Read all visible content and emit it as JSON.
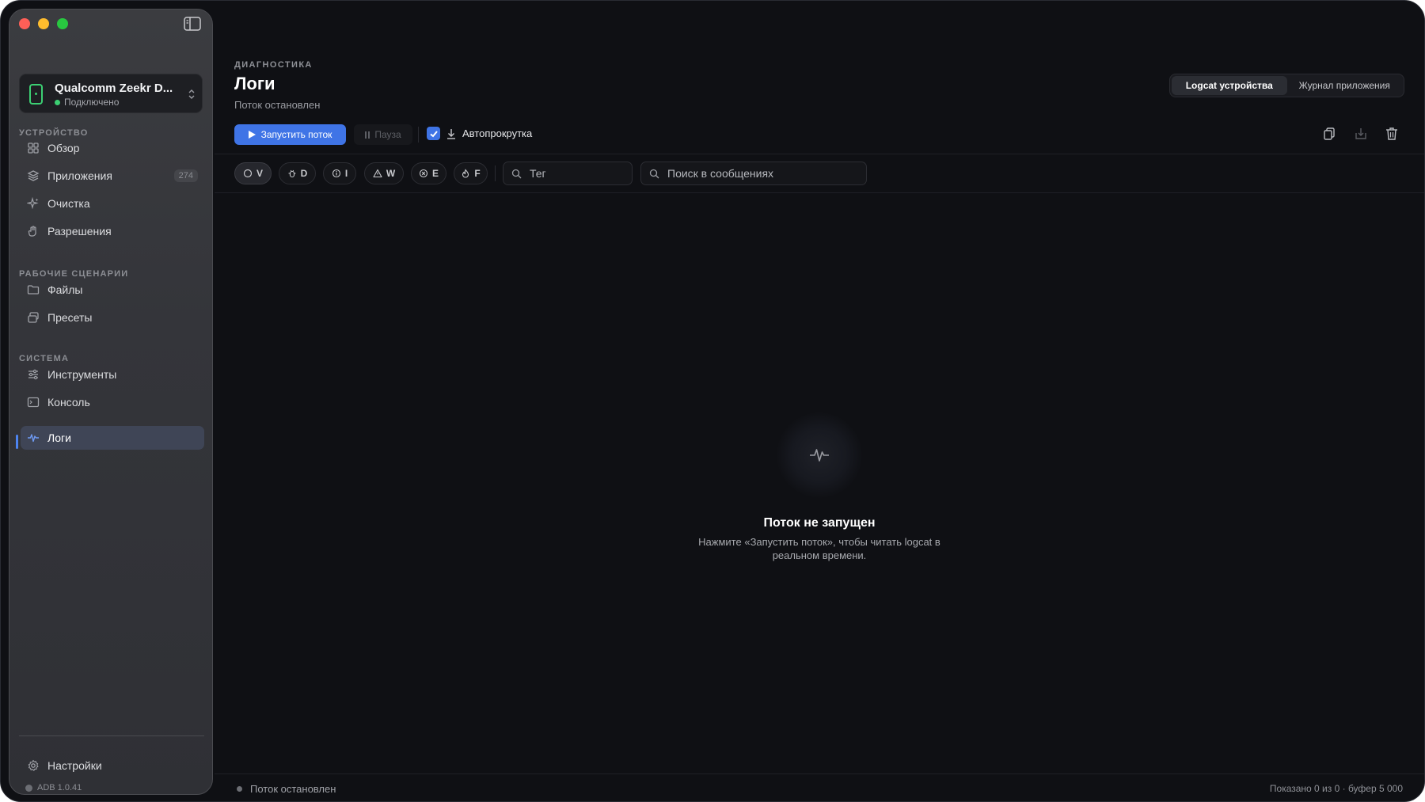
{
  "sidebar": {
    "device": {
      "name": "Qualcomm Zeekr D...",
      "status": "Подключено"
    },
    "sections": [
      {
        "title": "УСТРОЙСТВО"
      },
      {
        "title": "РАБОЧИЕ СЦЕНАРИИ"
      },
      {
        "title": "СИСТЕМА"
      }
    ],
    "items": [
      {
        "label": "Обзор",
        "icon": "grid-icon"
      },
      {
        "label": "Приложения",
        "icon": "layers-icon",
        "badge": "274"
      },
      {
        "label": "Очистка",
        "icon": "sparkles-icon"
      },
      {
        "label": "Разрешения",
        "icon": "hand-icon"
      },
      {
        "label": "Файлы",
        "icon": "folder-icon"
      },
      {
        "label": "Пресеты",
        "icon": "presets-icon"
      },
      {
        "label": "Инструменты",
        "icon": "sliders-icon"
      },
      {
        "label": "Консоль",
        "icon": "terminal-icon"
      },
      {
        "label": "Логи",
        "icon": "waveform-icon",
        "active": true
      }
    ],
    "settings": {
      "label": "Настройки",
      "icon": "gear-icon"
    },
    "version": "ADB 1.0.41"
  },
  "header": {
    "eyebrow": "ДИАГНОСТИКА",
    "title": "Логи",
    "subtitle": "Поток остановлен",
    "tabs": [
      {
        "label": "Logcat устройства",
        "active": true
      },
      {
        "label": "Журнал приложения",
        "active": false
      }
    ]
  },
  "toolbar": {
    "start_label": "Запустить поток",
    "pause_label": "Пауза",
    "autoscroll_label": "Автопрокрутка",
    "autoscroll_checked": true
  },
  "filters": {
    "levels": [
      "V",
      "D",
      "I",
      "W",
      "E",
      "F"
    ],
    "tag_placeholder": "Тег",
    "search_placeholder": "Поиск в сообщениях"
  },
  "empty_state": {
    "title": "Поток не запущен",
    "text": "Нажмите «Запустить поток», чтобы читать logcat в реальном времени."
  },
  "statusbar": {
    "left": "Поток остановлен",
    "right": "Показано 0 из 0 · буфер 5 000"
  },
  "colors": {
    "accent": "#3f74e6",
    "connected": "#3ccf73",
    "window_bg": "#0f1014",
    "sidebar_bg": "#36373c"
  }
}
